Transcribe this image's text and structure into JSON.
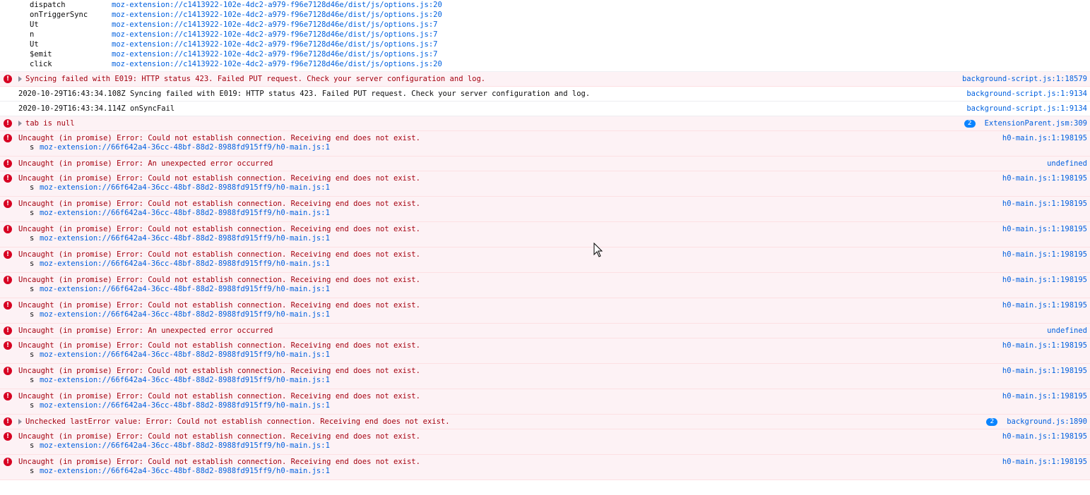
{
  "stack_trace": [
    {
      "fn": "dispatch",
      "loc": "moz-extension://c1413922-102e-4dc2-a979-f96e7128d46e/dist/js/options.js:20"
    },
    {
      "fn": "onTriggerSync",
      "loc": "moz-extension://c1413922-102e-4dc2-a979-f96e7128d46e/dist/js/options.js:20"
    },
    {
      "fn": "Ut",
      "loc": "moz-extension://c1413922-102e-4dc2-a979-f96e7128d46e/dist/js/options.js:7"
    },
    {
      "fn": "n",
      "loc": "moz-extension://c1413922-102e-4dc2-a979-f96e7128d46e/dist/js/options.js:7"
    },
    {
      "fn": "Ut",
      "loc": "moz-extension://c1413922-102e-4dc2-a979-f96e7128d46e/dist/js/options.js:7"
    },
    {
      "fn": "$emit",
      "loc": "moz-extension://c1413922-102e-4dc2-a979-f96e7128d46e/dist/js/options.js:7"
    },
    {
      "fn": "click",
      "loc": "moz-extension://c1413922-102e-4dc2-a979-f96e7128d46e/dist/js/options.js:20"
    }
  ],
  "messages": [
    {
      "type": "error",
      "expandable": true,
      "text": "Syncing failed with E019: HTTP status 423. Failed PUT request. Check your server configuration and log.",
      "source": "background-script.js:1:18579"
    },
    {
      "type": "log",
      "text": "2020-10-29T16:43:34.108Z Syncing failed with E019: HTTP status 423. Failed PUT request. Check your server configuration and log.",
      "source": "background-script.js:1:9134"
    },
    {
      "type": "log",
      "text": "2020-10-29T16:43:34.114Z onSyncFail",
      "source": "background-script.js:1:9134"
    },
    {
      "type": "error",
      "expandable": true,
      "text": "tab is null",
      "source": "ExtensionParent.jsm:309",
      "badge": "2"
    },
    {
      "type": "error",
      "text": "Uncaught (in promise) Error: Could not establish connection. Receiving end does not exist.",
      "source": "h0-main.js:1:198195",
      "frame_fn": "s",
      "frame_loc": "moz-extension://66f642a4-36cc-48bf-88d2-8988fd915ff9/h0-main.js:1"
    },
    {
      "type": "error",
      "text": "Uncaught (in promise) Error: An unexpected error occurred",
      "source": "undefined"
    },
    {
      "type": "error",
      "text": "Uncaught (in promise) Error: Could not establish connection. Receiving end does not exist.",
      "source": "h0-main.js:1:198195",
      "frame_fn": "s",
      "frame_loc": "moz-extension://66f642a4-36cc-48bf-88d2-8988fd915ff9/h0-main.js:1"
    },
    {
      "type": "error",
      "text": "Uncaught (in promise) Error: Could not establish connection. Receiving end does not exist.",
      "source": "h0-main.js:1:198195",
      "frame_fn": "s",
      "frame_loc": "moz-extension://66f642a4-36cc-48bf-88d2-8988fd915ff9/h0-main.js:1"
    },
    {
      "type": "error",
      "text": "Uncaught (in promise) Error: Could not establish connection. Receiving end does not exist.",
      "source": "h0-main.js:1:198195",
      "frame_fn": "s",
      "frame_loc": "moz-extension://66f642a4-36cc-48bf-88d2-8988fd915ff9/h0-main.js:1"
    },
    {
      "type": "error",
      "text": "Uncaught (in promise) Error: Could not establish connection. Receiving end does not exist.",
      "source": "h0-main.js:1:198195",
      "frame_fn": "s",
      "frame_loc": "moz-extension://66f642a4-36cc-48bf-88d2-8988fd915ff9/h0-main.js:1"
    },
    {
      "type": "error",
      "text": "Uncaught (in promise) Error: Could not establish connection. Receiving end does not exist.",
      "source": "h0-main.js:1:198195",
      "frame_fn": "s",
      "frame_loc": "moz-extension://66f642a4-36cc-48bf-88d2-8988fd915ff9/h0-main.js:1"
    },
    {
      "type": "error",
      "text": "Uncaught (in promise) Error: Could not establish connection. Receiving end does not exist.",
      "source": "h0-main.js:1:198195",
      "frame_fn": "s",
      "frame_loc": "moz-extension://66f642a4-36cc-48bf-88d2-8988fd915ff9/h0-main.js:1"
    },
    {
      "type": "error",
      "text": "Uncaught (in promise) Error: An unexpected error occurred",
      "source": "undefined"
    },
    {
      "type": "error",
      "text": "Uncaught (in promise) Error: Could not establish connection. Receiving end does not exist.",
      "source": "h0-main.js:1:198195",
      "frame_fn": "s",
      "frame_loc": "moz-extension://66f642a4-36cc-48bf-88d2-8988fd915ff9/h0-main.js:1"
    },
    {
      "type": "error",
      "text": "Uncaught (in promise) Error: Could not establish connection. Receiving end does not exist.",
      "source": "h0-main.js:1:198195",
      "frame_fn": "s",
      "frame_loc": "moz-extension://66f642a4-36cc-48bf-88d2-8988fd915ff9/h0-main.js:1"
    },
    {
      "type": "error",
      "text": "Uncaught (in promise) Error: Could not establish connection. Receiving end does not exist.",
      "source": "h0-main.js:1:198195",
      "frame_fn": "s",
      "frame_loc": "moz-extension://66f642a4-36cc-48bf-88d2-8988fd915ff9/h0-main.js:1"
    },
    {
      "type": "error",
      "expandable": true,
      "text": "Unchecked lastError value: Error: Could not establish connection. Receiving end does not exist.",
      "source": "background.js:1890",
      "badge": "2"
    },
    {
      "type": "error",
      "text": "Uncaught (in promise) Error: Could not establish connection. Receiving end does not exist.",
      "source": "h0-main.js:1:198195",
      "frame_fn": "s",
      "frame_loc": "moz-extension://66f642a4-36cc-48bf-88d2-8988fd915ff9/h0-main.js:1"
    },
    {
      "type": "error",
      "text": "Uncaught (in promise) Error: Could not establish connection. Receiving end does not exist.",
      "source": "h0-main.js:1:198195",
      "frame_fn": "s",
      "frame_loc": "moz-extension://66f642a4-36cc-48bf-88d2-8988fd915ff9/h0-main.js:1"
    }
  ],
  "colors": {
    "error_bg": "#fdf2f5",
    "error_text": "#a4000f",
    "link": "#0060df",
    "badge": "#0a84ff"
  }
}
